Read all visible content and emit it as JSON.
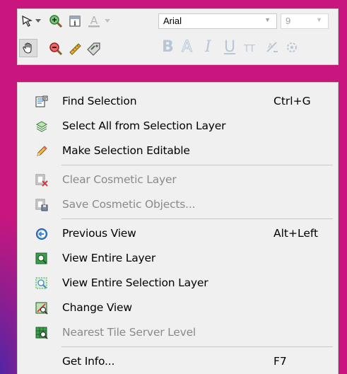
{
  "toolbar": {
    "font_name": "Arial",
    "font_size": "9",
    "icons_row1": [
      "select-arrow-icon",
      "dropdown-caret-icon",
      "zoom-in-icon",
      "info-tool-icon",
      "text-color-icon"
    ],
    "icons_row2": [
      "pan-hand-icon",
      "zoom-out-icon",
      "ruler-icon",
      "label-tag-icon",
      "bold-icon",
      "outline-icon",
      "italic-icon",
      "underline-icon",
      "superscript-icon",
      "rotate-label-icon",
      "label-style-icon"
    ],
    "format_glyphs": {
      "bold": "B",
      "outline": "A",
      "italic": "I",
      "underline": "U",
      "superscript": "TT"
    }
  },
  "menu": {
    "items": [
      {
        "label": "Find Selection",
        "shortcut": "Ctrl+G",
        "icon": "find-selection-icon",
        "enabled": true
      },
      {
        "label": "Select All from Selection Layer",
        "shortcut": "",
        "icon": "layers-icon",
        "enabled": true
      },
      {
        "label": "Make Selection Editable",
        "shortcut": "",
        "icon": "pencil-icon",
        "enabled": true
      },
      {
        "label": "Clear Cosmetic Layer",
        "shortcut": "",
        "icon": "clear-cosmetic-icon",
        "enabled": false
      },
      {
        "label": "Save Cosmetic Objects...",
        "shortcut": "",
        "icon": "save-cosmetic-icon",
        "enabled": false
      },
      {
        "label": "Previous View",
        "shortcut": "Alt+Left",
        "icon": "previous-view-icon",
        "enabled": true
      },
      {
        "label": "View Entire Layer",
        "shortcut": "",
        "icon": "view-entire-layer-icon",
        "enabled": true
      },
      {
        "label": "View Entire Selection Layer",
        "shortcut": "",
        "icon": "view-selection-layer-icon",
        "enabled": true
      },
      {
        "label": "Change View",
        "shortcut": "",
        "icon": "change-view-icon",
        "enabled": true
      },
      {
        "label": "Nearest Tile Server Level",
        "shortcut": "",
        "icon": "tile-server-icon",
        "enabled": false
      },
      {
        "label": "Get Info...",
        "shortcut": "F7",
        "icon": "get-info-icon",
        "enabled": true
      }
    ]
  },
  "colors": {
    "background": "#c8167e",
    "menu_bg": "#f0f0f0",
    "disabled_text": "#8a8a8a",
    "accent_blue": "#3b86d6",
    "accent_green": "#3aa04a"
  }
}
